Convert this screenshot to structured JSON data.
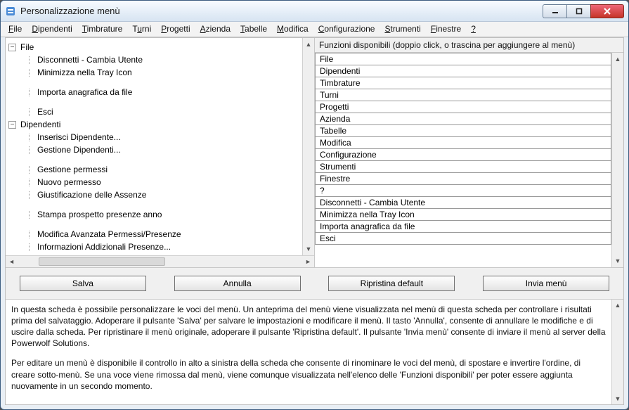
{
  "window": {
    "title": "Personalizzazione menù"
  },
  "menubar": [
    {
      "label": "File",
      "u": 0
    },
    {
      "label": "Dipendenti",
      "u": 0
    },
    {
      "label": "Timbrature",
      "u": 0
    },
    {
      "label": "Turni",
      "u": 1
    },
    {
      "label": "Progetti",
      "u": 0
    },
    {
      "label": "Azienda",
      "u": 0
    },
    {
      "label": "Tabelle",
      "u": 0
    },
    {
      "label": "Modifica",
      "u": 0
    },
    {
      "label": "Configurazione",
      "u": 0
    },
    {
      "label": "Strumenti",
      "u": 0
    },
    {
      "label": "Finestre",
      "u": 0
    },
    {
      "label": "?",
      "u": 0
    }
  ],
  "tree": [
    {
      "label": "File",
      "expanded": true,
      "children": [
        {
          "label": "Disconnetti - Cambia Utente"
        },
        {
          "label": "Minimizza nella Tray Icon"
        },
        {
          "blank": true
        },
        {
          "label": "Importa anagrafica da file"
        },
        {
          "blank": true
        },
        {
          "label": "Esci"
        }
      ]
    },
    {
      "label": "Dipendenti",
      "expanded": true,
      "children": [
        {
          "label": "Inserisci Dipendente..."
        },
        {
          "label": "Gestione Dipendenti..."
        },
        {
          "blank": true
        },
        {
          "label": "Gestione permessi"
        },
        {
          "label": "Nuovo permesso"
        },
        {
          "label": "Giustificazione delle Assenze"
        },
        {
          "blank": true
        },
        {
          "label": "Stampa prospetto presenze anno"
        },
        {
          "blank": true
        },
        {
          "label": "Modifica Avanzata Permessi/Presenze"
        },
        {
          "label": "Informazioni Addizionali Presenze..."
        }
      ]
    }
  ],
  "available": {
    "header": "Funzioni disponibili (doppio click, o trascina per aggiungere al menù)",
    "items": [
      "File",
      "Dipendenti",
      "Timbrature",
      "Turni",
      "Progetti",
      "Azienda",
      "Tabelle",
      "Modifica",
      "Configurazione",
      "Strumenti",
      "Finestre",
      "?",
      "Disconnetti - Cambia Utente",
      "Minimizza nella Tray Icon",
      "Importa anagrafica da file",
      "Esci"
    ]
  },
  "buttons": {
    "save": "Salva",
    "cancel": "Annulla",
    "restore": "Ripristina default",
    "send": "Invia menù"
  },
  "help": {
    "p1": "In questa scheda è possibile personalizzare le voci del menù. Un anteprima del menù viene visualizzata nel menù di questa scheda per controllare i risultati prima del salvataggio. Adoperare il pulsante 'Salva' per salvare le impostazioni e modificare il menù. Il tasto 'Annulla', consente di annullare le modifiche e di uscire dalla scheda. Per ripristinare il menù originale, adoperare il pulsante 'Ripristina default'. Il pulsante 'Invia menù' consente di inviare il menù al server della Powerwolf Solutions.",
    "p2": "Per editare un menù è disponibile il controllo in alto a sinistra della scheda che consente di rinominare le voci del menù, di spostare e invertire l'ordine, di creare sotto-menù. Se una voce viene rimossa dal menù, viene comunque visualizzata nell'elenco delle 'Funzioni disponibili' per poter essere aggiunta nuovamente in un secondo momento."
  }
}
